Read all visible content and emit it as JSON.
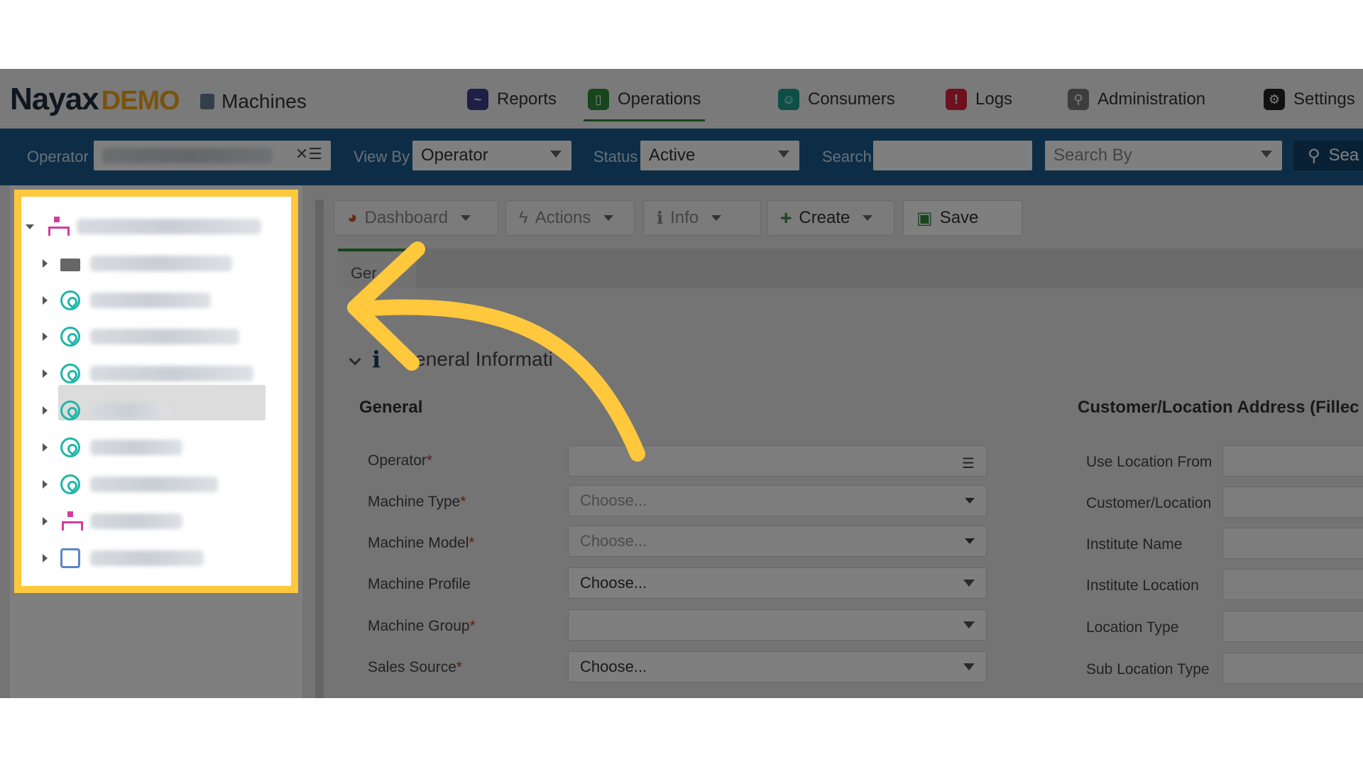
{
  "app": {
    "brand": "Nayax",
    "brand_suffix": "DEMO",
    "module": "Machines"
  },
  "nav": {
    "reports": "Reports",
    "operations": "Operations",
    "consumers": "Consumers",
    "logs": "Logs",
    "administration": "Administration",
    "settings": "Settings"
  },
  "filters": {
    "operator_label": "Operator",
    "viewby_label": "View By",
    "viewby_value": "Operator",
    "status_label": "Status",
    "status_value": "Active",
    "search_label": "Search",
    "searchby_placeholder": "Search By",
    "search_button": "Sea"
  },
  "toolbar": {
    "dashboard": "Dashboard",
    "actions": "Actions",
    "info": "Info",
    "create": "Create",
    "save": "Save"
  },
  "tabs": {
    "general": "Ger"
  },
  "form": {
    "section_title": "eneral Informati",
    "left_group": "General",
    "right_group": "Customer/Location Address (Fillec",
    "operator": "Operator",
    "machine_type": "Machine Type",
    "machine_type_placeholder": "Choose...",
    "machine_model": "Machine Model",
    "machine_model_placeholder": "Choose...",
    "machine_profile": "Machine Profile",
    "machine_profile_value": "Choose...",
    "machine_group": "Machine Group",
    "sales_source": "Sales Source",
    "sales_source_value": "Choose...",
    "required_mark": "*",
    "use_location_from": "Use Location From",
    "customer_location": "Customer/Location",
    "institute_name": "Institute Name",
    "institute_location": "Institute Location",
    "location_type": "Location Type",
    "sub_location_type": "Sub Location Type"
  },
  "colors": {
    "filter_bar": "#1a5a8c",
    "highlight": "#ffc83d",
    "active_tab": "#2e8b3a"
  }
}
